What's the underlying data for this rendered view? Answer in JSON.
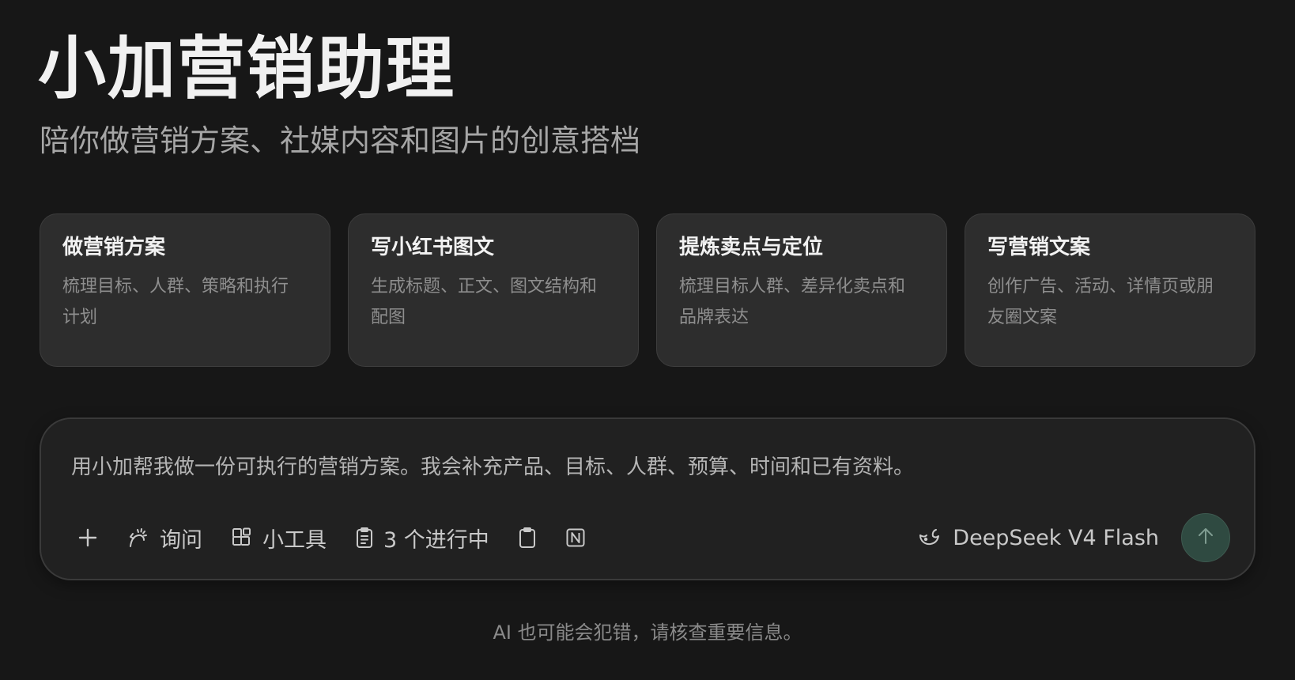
{
  "header": {
    "title": "小加营销助理",
    "subtitle": "陪你做营销方案、社媒内容和图片的创意搭档"
  },
  "cards": [
    {
      "title": "做营销方案",
      "desc": "梳理目标、人群、策略和执行计划"
    },
    {
      "title": "写小红书图文",
      "desc": "生成标题、正文、图文结构和配图"
    },
    {
      "title": "提炼卖点与定位",
      "desc": "梳理目标人群、差异化卖点和品牌表达"
    },
    {
      "title": "写营销文案",
      "desc": "创作广告、活动、详情页或朋友圈文案"
    }
  ],
  "composer": {
    "value": "用小加帮我做一份可执行的营销方案。我会补充产品、目标、人群、预算、时间和已有资料。",
    "toolbar": {
      "ask_label": "询问",
      "tools_label": "小工具",
      "tasks_label": "3 个进行中",
      "model_label": "DeepSeek V4 Flash"
    }
  },
  "footer": {
    "note": "AI 也可能会犯错，请核查重要信息。"
  },
  "colors": {
    "background": "#171717",
    "card_bg": "#2d2d2d",
    "composer_bg": "#212121",
    "send_button": "#2f4a41"
  },
  "icons": [
    "plus-icon",
    "ask-icon",
    "tools-icon",
    "tasks-icon",
    "clipboard-icon",
    "notion-icon",
    "deepseek-icon",
    "arrow-up-icon"
  ]
}
